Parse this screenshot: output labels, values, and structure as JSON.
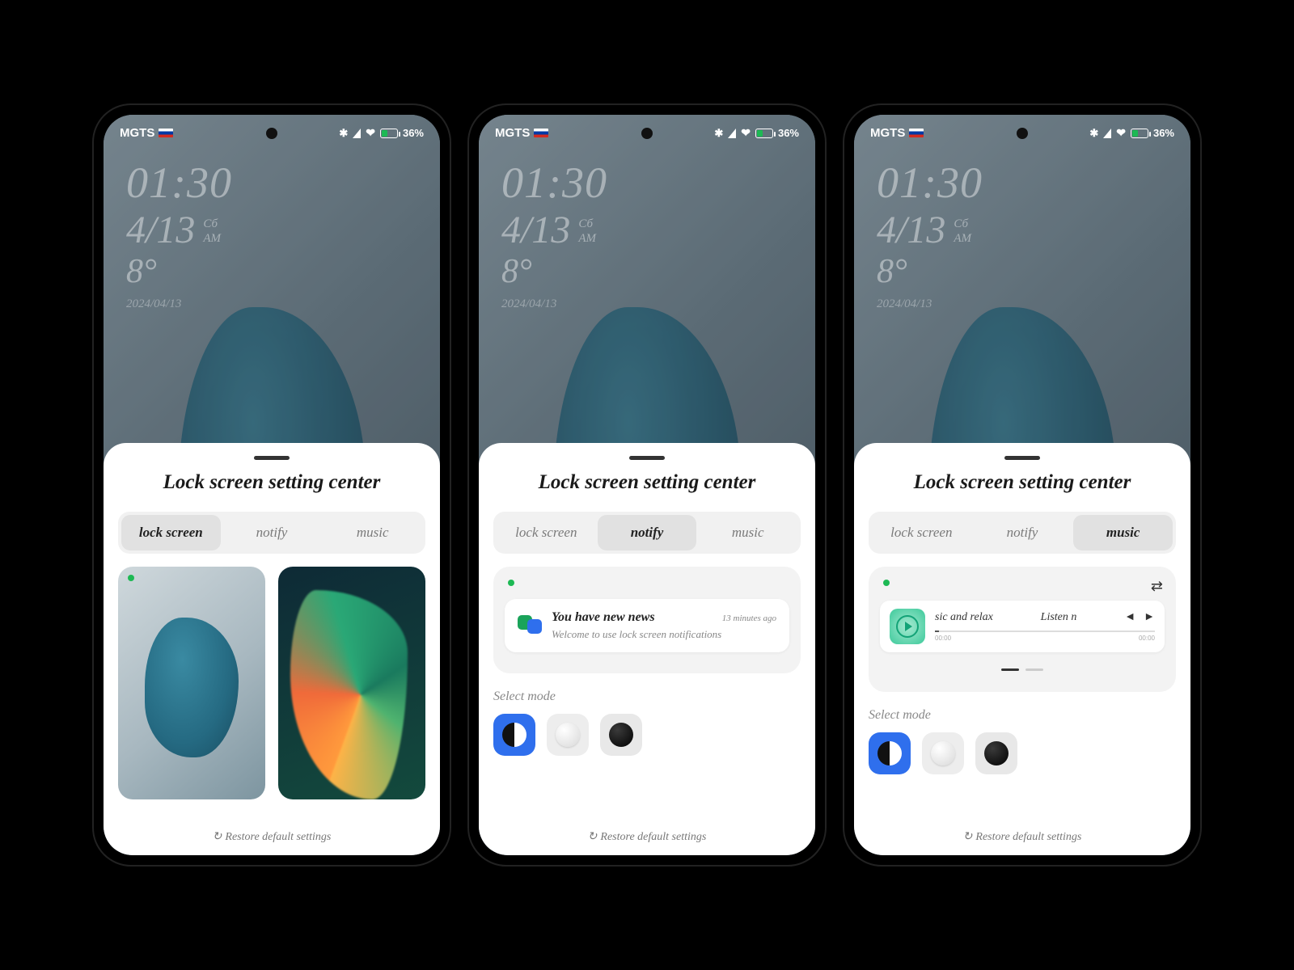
{
  "status": {
    "carrier": "MGTS",
    "battery_pct": "36%",
    "bt_icon": "✱",
    "heart_icon": "❤"
  },
  "clock": {
    "time": "01:30",
    "date": "4/13",
    "day": "Сб",
    "ampm": "AM",
    "temp": "8°",
    "fulldate": "2024/04/13"
  },
  "panel": {
    "title": "Lock screen setting center",
    "tabs": [
      "lock screen",
      "notify",
      "music"
    ],
    "restore": "Restore default settings",
    "restore_icon": "↻",
    "select_mode": "Select mode"
  },
  "notify": {
    "title": "You have new news",
    "time": "13 minutes ago",
    "subtitle": "Welcome to use lock screen notifications"
  },
  "music": {
    "track": "sic and relax",
    "action": "Listen n",
    "t0": "00:00",
    "t1": "00:00",
    "swap_icon": "⇄",
    "prev_icon": "◄",
    "next_icon": "►"
  }
}
